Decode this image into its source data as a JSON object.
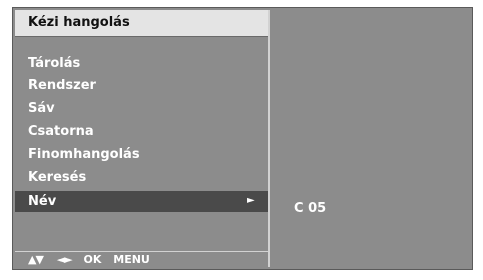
{
  "menu": {
    "title": "Kézi hangolás",
    "items": [
      {
        "label": "Tárolás"
      },
      {
        "label": "Rendszer"
      },
      {
        "label": "Sáv"
      },
      {
        "label": "Csatorna"
      },
      {
        "label": "Finomhangolás"
      },
      {
        "label": "Keresés"
      },
      {
        "label": "Név",
        "selected": true
      }
    ],
    "submenu_arrow": "►"
  },
  "footer": {
    "nav_arrows": "▲▼",
    "lr_arrows": "◄►",
    "ok_label": "OK",
    "menu_label": "MENU"
  },
  "value_panel": {
    "value": "C 05"
  },
  "colors": {
    "panel_bg": "#8c8c8c",
    "title_bg": "#e4e4e4",
    "selected_bg": "#4a4a4a",
    "text": "#ffffff"
  }
}
